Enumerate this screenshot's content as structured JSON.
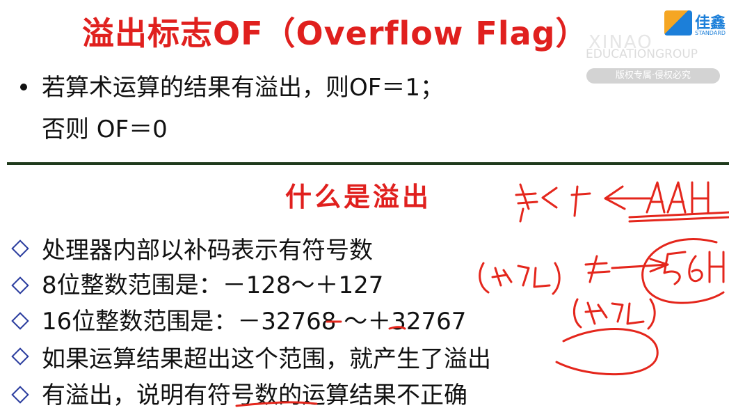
{
  "header": {
    "title": "溢出标志OF（Overflow Flag）",
    "logo_text": "佳鑫",
    "logo_sub": "STANDARD",
    "watermark_top": "XINAO",
    "watermark_group": "EDUCATIONGROUP",
    "watermark_badge": "版权专属·侵权必究"
  },
  "intro": {
    "line1": "若算术运算的结果有溢出，则OF＝1；",
    "line2": "否则 OF＝0"
  },
  "section_title": "什么是溢出",
  "items": [
    "处理器内部以补码表示有符号数",
    "8位整数范围是：－128～＋127",
    "16位整数范围是：－32768 ～＋32767",
    " 如果运算结果超出这个范围，就产生了溢出",
    "有溢出，说明有符号数的运算结果不正确"
  ],
  "colors": {
    "title_red": "#e0201e",
    "ink_red": "#e4261c",
    "diamond_blue": "#2a3c9e",
    "divider": "#1f3a1c"
  }
}
